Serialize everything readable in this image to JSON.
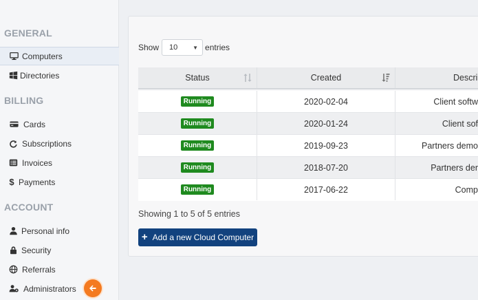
{
  "sidebar": {
    "sections": {
      "general": "GENERAL",
      "billing": "BILLING",
      "account": "ACCOUNT"
    },
    "items": {
      "computers": {
        "label": "Computers",
        "icon": "monitor-icon"
      },
      "directories": {
        "label": "Directories",
        "icon": "windows-icon"
      },
      "cards": {
        "label": "Cards",
        "icon": "credit-card-icon"
      },
      "subscriptions": {
        "label": "Subscriptions",
        "icon": "refresh-icon"
      },
      "invoices": {
        "label": "Invoices",
        "icon": "list-icon"
      },
      "payments": {
        "label": "Payments",
        "icon": "dollar-icon"
      },
      "personal_info": {
        "label": "Personal info",
        "icon": "user-icon"
      },
      "security": {
        "label": "Security",
        "icon": "lock-icon"
      },
      "referrals": {
        "label": "Referrals",
        "icon": "globe-icon"
      },
      "administrators": {
        "label": "Administrators",
        "icon": "users-cog-icon"
      }
    },
    "collapse_icon": "arrow-left-icon"
  },
  "table_controls": {
    "show_label": "Show",
    "entries_label": "entries",
    "page_length": "10"
  },
  "table": {
    "headers": {
      "status": "Status",
      "created": "Created",
      "description": "Descri"
    },
    "rows": [
      {
        "status": "Running",
        "created": "2020-02-04",
        "description": "Client softw"
      },
      {
        "status": "Running",
        "created": "2020-01-24",
        "description": "Client sof"
      },
      {
        "status": "Running",
        "created": "2019-09-23",
        "description": "Partners demo"
      },
      {
        "status": "Running",
        "created": "2018-07-20",
        "description": "Partners der"
      },
      {
        "status": "Running",
        "created": "2017-06-22",
        "description": "Comp"
      }
    ]
  },
  "info_text": "Showing 1 to 5 of 5 entries",
  "add_button": {
    "label": "Add a new Cloud Computer",
    "icon": "plus-icon"
  },
  "colors": {
    "badge_running": "#1f8a1f",
    "primary_button": "#12427e",
    "collapse_button": "#f47a20"
  }
}
